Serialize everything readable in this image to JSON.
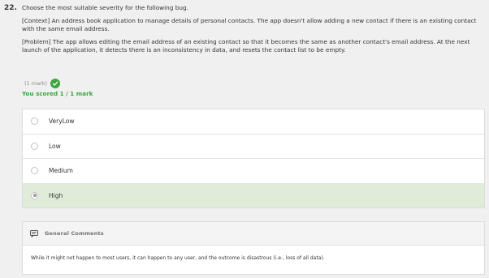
{
  "question": {
    "number": "22.",
    "prompt": "Choose the most suitable severity for the following bug.",
    "context": "[Context] An address book application to manage details of personal contacts. The app doesn't allow adding a new contact if there is an existing contact with the same email address.",
    "problem": "[Problem] The app allows editing the email address of an existing contact so that it becomes the same as another contact's email address. At the next launch of the application, it detects there is an inconsistency in data, and resets the contact list to be empty."
  },
  "marks": {
    "label": "(1 mark)",
    "icon": "check-circle-icon"
  },
  "score": {
    "text": "You scored 1 / 1 mark"
  },
  "options": [
    {
      "label": "VeryLow",
      "selected": false
    },
    {
      "label": "Low",
      "selected": false
    },
    {
      "label": "Medium",
      "selected": false
    },
    {
      "label": "High",
      "selected": true
    }
  ],
  "comments": {
    "title": "General Comments",
    "icon": "comment-icon",
    "text": "While it might not happen to most users, it can happen to any user, and the outcome is disastrous (i.e., loss of all data)."
  },
  "colors": {
    "success": "#3aa63f",
    "selected_bg": "#e0ecd9",
    "page_bg": "#f0f0f0"
  }
}
